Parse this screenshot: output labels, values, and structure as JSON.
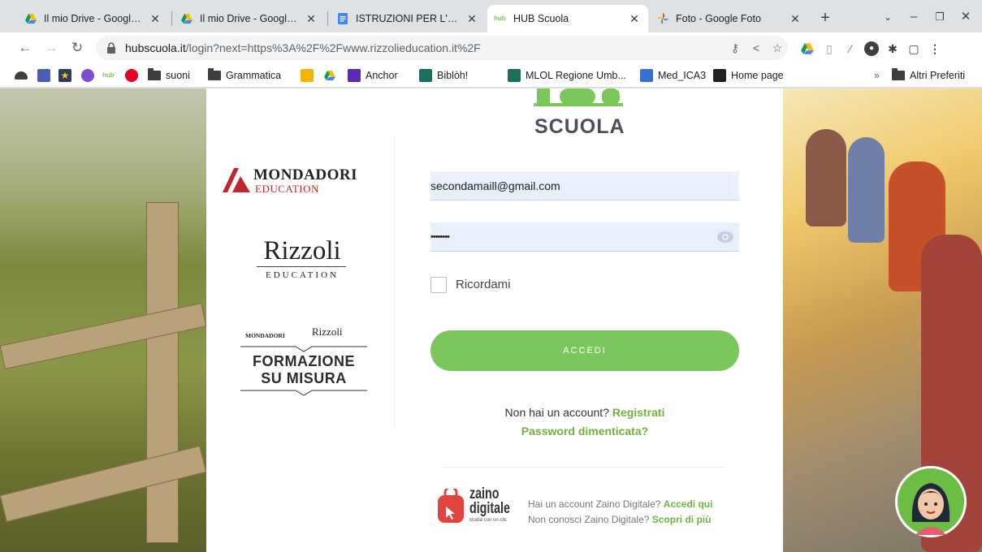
{
  "tabs": [
    {
      "title": "Il mio Drive - Google Dri",
      "icon": "google-drive-icon",
      "active": false
    },
    {
      "title": "Il mio Drive - Google Dri",
      "icon": "google-drive-icon",
      "active": false
    },
    {
      "title": "ISTRUZIONI PER L'ACQU",
      "icon": "google-docs-icon",
      "active": false
    },
    {
      "title": "HUB Scuola",
      "icon": "hub-icon",
      "active": true
    },
    {
      "title": "Foto - Google Foto",
      "icon": "google-photos-icon",
      "active": false
    }
  ],
  "toolbar": {
    "url_host": "hubscuola.it",
    "url_path": "/login?next=https%3A%2F%2Fwww.rizzolieducation.it%2F"
  },
  "bookmarks": [
    {
      "label": "",
      "icon": "cloud-icon"
    },
    {
      "label": "",
      "icon": "puzzle-app-icon"
    },
    {
      "label": "",
      "icon": "star-app-icon"
    },
    {
      "label": "",
      "icon": "wordpress-icon"
    },
    {
      "label": "",
      "icon": "hub-icon"
    },
    {
      "label": "",
      "icon": "pinterest-icon"
    },
    {
      "label": "suoni",
      "icon": "folder-icon"
    },
    {
      "label": "Grammatica",
      "icon": "folder-icon"
    },
    {
      "label": "",
      "icon": "classroom-icon"
    },
    {
      "label": "",
      "icon": "google-drive-icon"
    },
    {
      "label": "Anchor",
      "icon": "anchor-icon"
    },
    {
      "label": "Biblòh!",
      "icon": "mlol-icon"
    },
    {
      "label": "MLOL Regione Umb...",
      "icon": "mlol-icon"
    },
    {
      "label": "Med_ICA3",
      "icon": "calendar-app-icon"
    },
    {
      "label": "Home page",
      "icon": "home-app-icon"
    }
  ],
  "bookmarks_more": "»",
  "bookmarks_other": "Altri Preferiti",
  "login": {
    "logo_hub": "HUB",
    "logo_scuola": "SCUOLA",
    "email_value": "secondamaill@gmail.com",
    "password_value": "••••••••",
    "remember_label": "Ricordami",
    "submit_label": "ACCEDI",
    "no_account_text": "Non hai un account?",
    "register_link": "Registrati",
    "forgot_link": "Password dimenticata?"
  },
  "brands": {
    "mondadori": "MONDADORI",
    "mondadori_sub": "EDUCATION",
    "rizzoli": "Rizzoli",
    "rizzoli_sub": "EDUCATION",
    "fsm_mondadori": "MONDADORI",
    "fsm_rizzoli": "Rizzoli",
    "fsm_title_1": "FORMAZIONE",
    "fsm_title_2": "SU MISURA"
  },
  "zaino": {
    "name_1": "zaino",
    "name_2": "digitale",
    "tagline": "studia con un clic",
    "line1_text": "Hai un account Zaino Digitale?",
    "line1_link": "Accedi qui",
    "line2_text": "Non conosci Zaino Digitale?",
    "line2_link": "Scopri di più"
  },
  "colors": {
    "accent_green": "#7cc75b",
    "link_green": "#71b33f",
    "field_bg": "#e8f0fe"
  }
}
